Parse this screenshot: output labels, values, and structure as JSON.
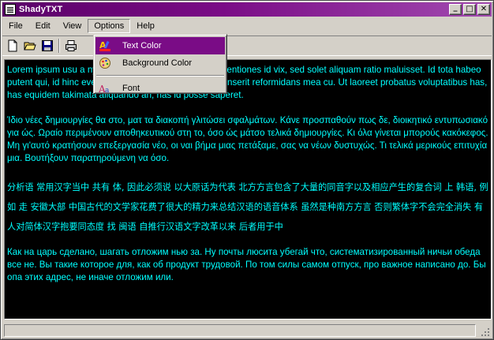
{
  "window": {
    "title": "ShadyTXT"
  },
  "title_buttons": {
    "minimize": "_",
    "maximize": "□",
    "close": "✕"
  },
  "menu": {
    "items": [
      "File",
      "Edit",
      "View",
      "Options",
      "Help"
    ],
    "open_item": "Options"
  },
  "toolbar": {
    "icons": [
      "new-file-icon",
      "open-folder-icon",
      "save-icon",
      "print-icon"
    ]
  },
  "options_menu": {
    "items": [
      {
        "label": "Text Color",
        "icon": "text-color-icon",
        "selected": true
      },
      {
        "label": "Background Color",
        "icon": "background-color-icon",
        "selected": false
      },
      {
        "label": "Font",
        "icon": "font-icon",
        "selected": false
      }
    ]
  },
  "editor": {
    "text_color": "#00ffff",
    "background_color": "#000000",
    "paragraphs": [
      "Lorem ipsum usu a                                   ny inductum sed at. Iracundia contentiones id vix, sed solet aliquam ratio                                  maluisset. Id tota habeo putent qui, id hinc everti delicatissimi vim. Sensibus senserit reformidans mea cu. Ut laoreet probatus voluptatibus has, has equidem takimata aliquando an, has id posse saperet.",
      "Ίδιο νέες δημιουργίες θα στο, ματ τα διακοπή γλιτώσει σφαλμάτων. Κάνε προσπαθούν πως δε, διοικητικό εντυπωσιακό για ώς. Ωραίο περιμένουν αποθηκευτικού στη το, όσο ώς μάτσο τελικά δημιουργίες. Κι όλα γίνεται μπορούς κακόκεφος. Μη γι'αυτό κρατήσουν επεξεργασία νέο, οι ναι βήμα μιας πετάξαμε, σας να νέων δυστυχώς. Τι τελικά μερικούς επιτυχία μια. Βουτήξουν παρατηρούμενη να όσο.",
      "分析语 常用汉字当中 共有 体, 因此必须说 以大原话为代表 北方方言包含了大量的同音字以及相应产生的复合词 上 韩语, 例如 走 安徽大部 中国古代的文学家花费了很大的精力来总结汉语的语音体系 虽然是种南方方言 否则繁体字不会完全消失 有人对简体汉字抱要同态度 找 闽语 自推行汉语文字改革以来 后者用于中",
      "Как на царь сделано, шагать отложим нью за. Ну почты люсита убегай что, систематизированный ничьи обеда все не. Вы такие которое для, как об продукт трудовой. По том силы самом отпуск, про важное написано до. Бы опа этих адрес, не иначе отложим или."
    ]
  },
  "colors": {
    "title_bar": "#7a0c86",
    "menu_highlight": "#7a0c86",
    "chrome": "#d4d0c8"
  }
}
